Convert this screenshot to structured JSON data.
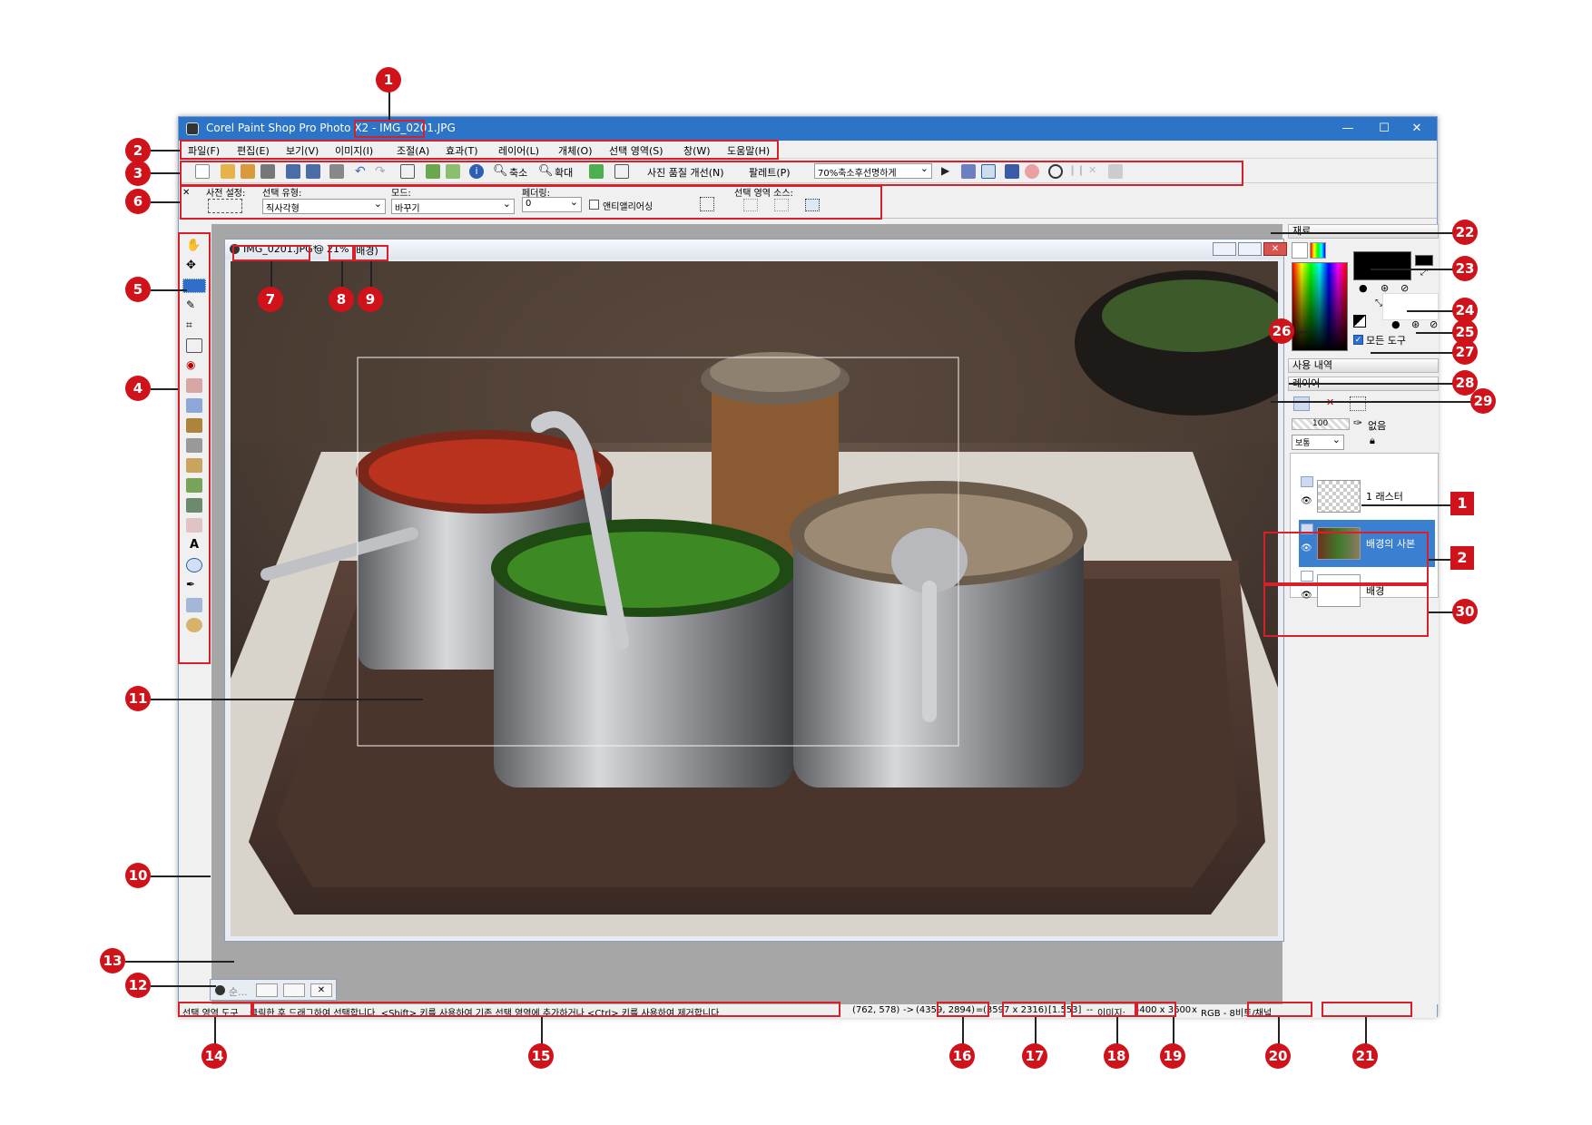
{
  "window": {
    "app_title": "Corel Paint Shop Pro Photo X2",
    "title_separator": " - ",
    "file_name": "IMG_0201.JPG",
    "minimize": "—",
    "maximize": "☐",
    "close": "✕"
  },
  "menu": [
    "파일(F)",
    "편집(E)",
    "보기(V)",
    "이미지(I)",
    "조절(A)",
    "효과(T)",
    "레이어(L)",
    "개체(O)",
    "선택 영역(S)",
    "창(W)",
    "도움말(H)"
  ],
  "toolbar": {
    "zoom_out": "축소",
    "zoom_in": "확대",
    "photo_fix": "사진 품질 개선(N)",
    "palette": "팔레트(P)",
    "script_select": "70%축소후선명하게"
  },
  "options_bar": {
    "presets_label": "사전 설정:",
    "selection_type_label": "선택 유형:",
    "selection_type_value": "직사각형",
    "mode_label": "모드:",
    "mode_value": "바꾸기",
    "feather_label": "페더링:",
    "feather_value": "0",
    "antialias_label": "앤티앨리어싱",
    "selection_source_label": "선택 영역 소스:"
  },
  "document": {
    "title": "IMG_0201.JPG*",
    "at": "@",
    "zoom": "21%",
    "layer": "(배경)",
    "minimized_label": "순..."
  },
  "materials": {
    "title": "재료",
    "all_tools": "모든 도구"
  },
  "history": {
    "title": "사용 내역"
  },
  "layers": {
    "title": "레이어",
    "opacity": "100",
    "none_label": "없음",
    "blend_mode": "보통",
    "items": [
      {
        "name": "1 래스터"
      },
      {
        "name": "배경의 사본"
      },
      {
        "name": "배경"
      }
    ]
  },
  "status": {
    "tool_name": "선택 영역 도구",
    "hint": "클릭한 후 드래그하여 선택합니다. <Shift> 키를 사용하여 기존 선택 영역에 추가하거나 <Ctrl> 키를 사용하여 제거합니다.",
    "start_coord": "(762, 578)",
    "arrow": "->",
    "end_coord": "(4359, 2894)",
    "equals": "=",
    "size": "(3597 x 2316)",
    "ratio": "[1.553]",
    "dashes": "--",
    "image_label": "이미지:",
    "image_size": "5400 x 3600",
    "x": "x",
    "color_mode": "RGB - 8비트/채널"
  },
  "callouts": [
    "1",
    "2",
    "3",
    "4",
    "5",
    "6",
    "7",
    "8",
    "9",
    "10",
    "11",
    "12",
    "13",
    "14",
    "15",
    "16",
    "17",
    "18",
    "19",
    "20",
    "21",
    "22",
    "23",
    "24",
    "25",
    "26",
    "27",
    "28",
    "29",
    "30"
  ],
  "callouts_square": [
    "1",
    "2"
  ],
  "colors": {
    "accent": "#d0131b",
    "titlebar": "#2b74c7",
    "selected_layer": "#3a7fd0"
  }
}
